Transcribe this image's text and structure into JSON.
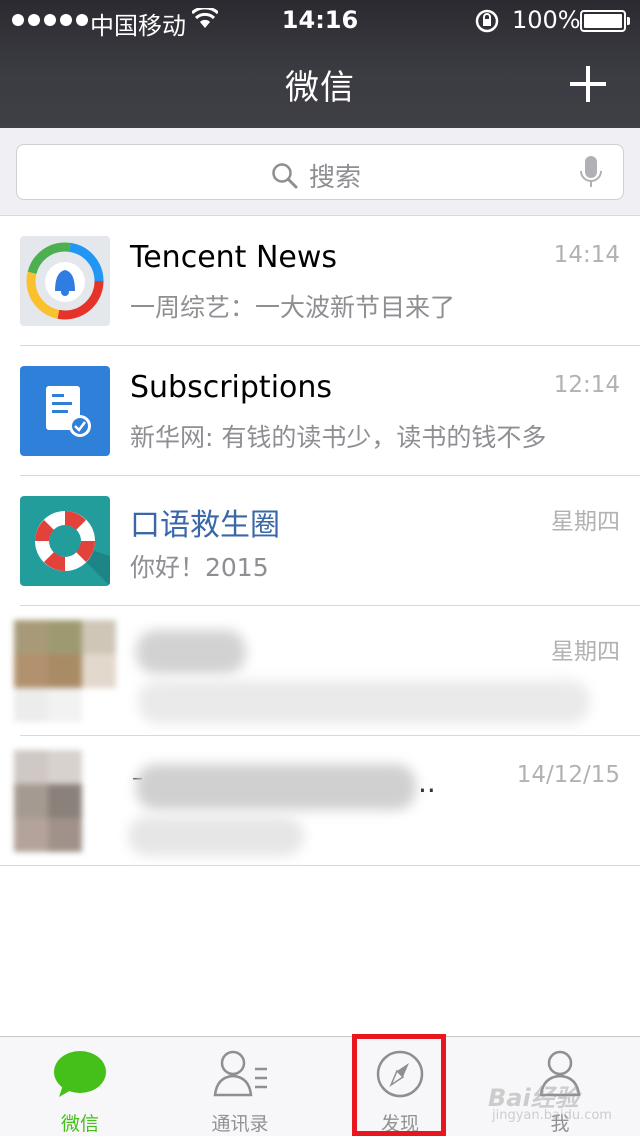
{
  "status_bar": {
    "carrier": "中国移动",
    "time": "14:16",
    "battery": "100%"
  },
  "nav": {
    "title": "微信",
    "add_icon": "plus-icon"
  },
  "search": {
    "placeholder": "搜索"
  },
  "chats": [
    {
      "name": "Tencent News",
      "time": "14:14",
      "preview": "一周综艺：一大波新节目来了",
      "avatar": "tencent-news-logo"
    },
    {
      "name": "Subscriptions",
      "time": "12:14",
      "preview": "新华网: 有钱的读书少，读书的钱不多",
      "avatar": "subscriptions-logo"
    },
    {
      "name": "口语救生圈",
      "time": "星期四",
      "preview": "你好！2015",
      "avatar": "lifebuoy-logo"
    },
    {
      "name": "",
      "time": "星期四",
      "preview": "",
      "avatar": "blurred-avatar"
    },
    {
      "name": "",
      "time": "14/12/15",
      "preview": "",
      "avatar": "blurred-avatar"
    }
  ],
  "tabs": [
    {
      "label": "微信",
      "icon": "chat-bubble-icon",
      "active": true
    },
    {
      "label": "通讯录",
      "icon": "contacts-icon",
      "active": false
    },
    {
      "label": "发现",
      "icon": "compass-icon",
      "active": false
    },
    {
      "label": "我",
      "icon": "profile-icon",
      "active": false
    }
  ],
  "colors": {
    "header": "#3b3b42",
    "accent_green": "#45c01a",
    "highlight_red": "#e8161f",
    "muted": "#8e8e93"
  },
  "watermark": {
    "text": "Bai经验",
    "sub": "jingyan.baidu.com"
  }
}
